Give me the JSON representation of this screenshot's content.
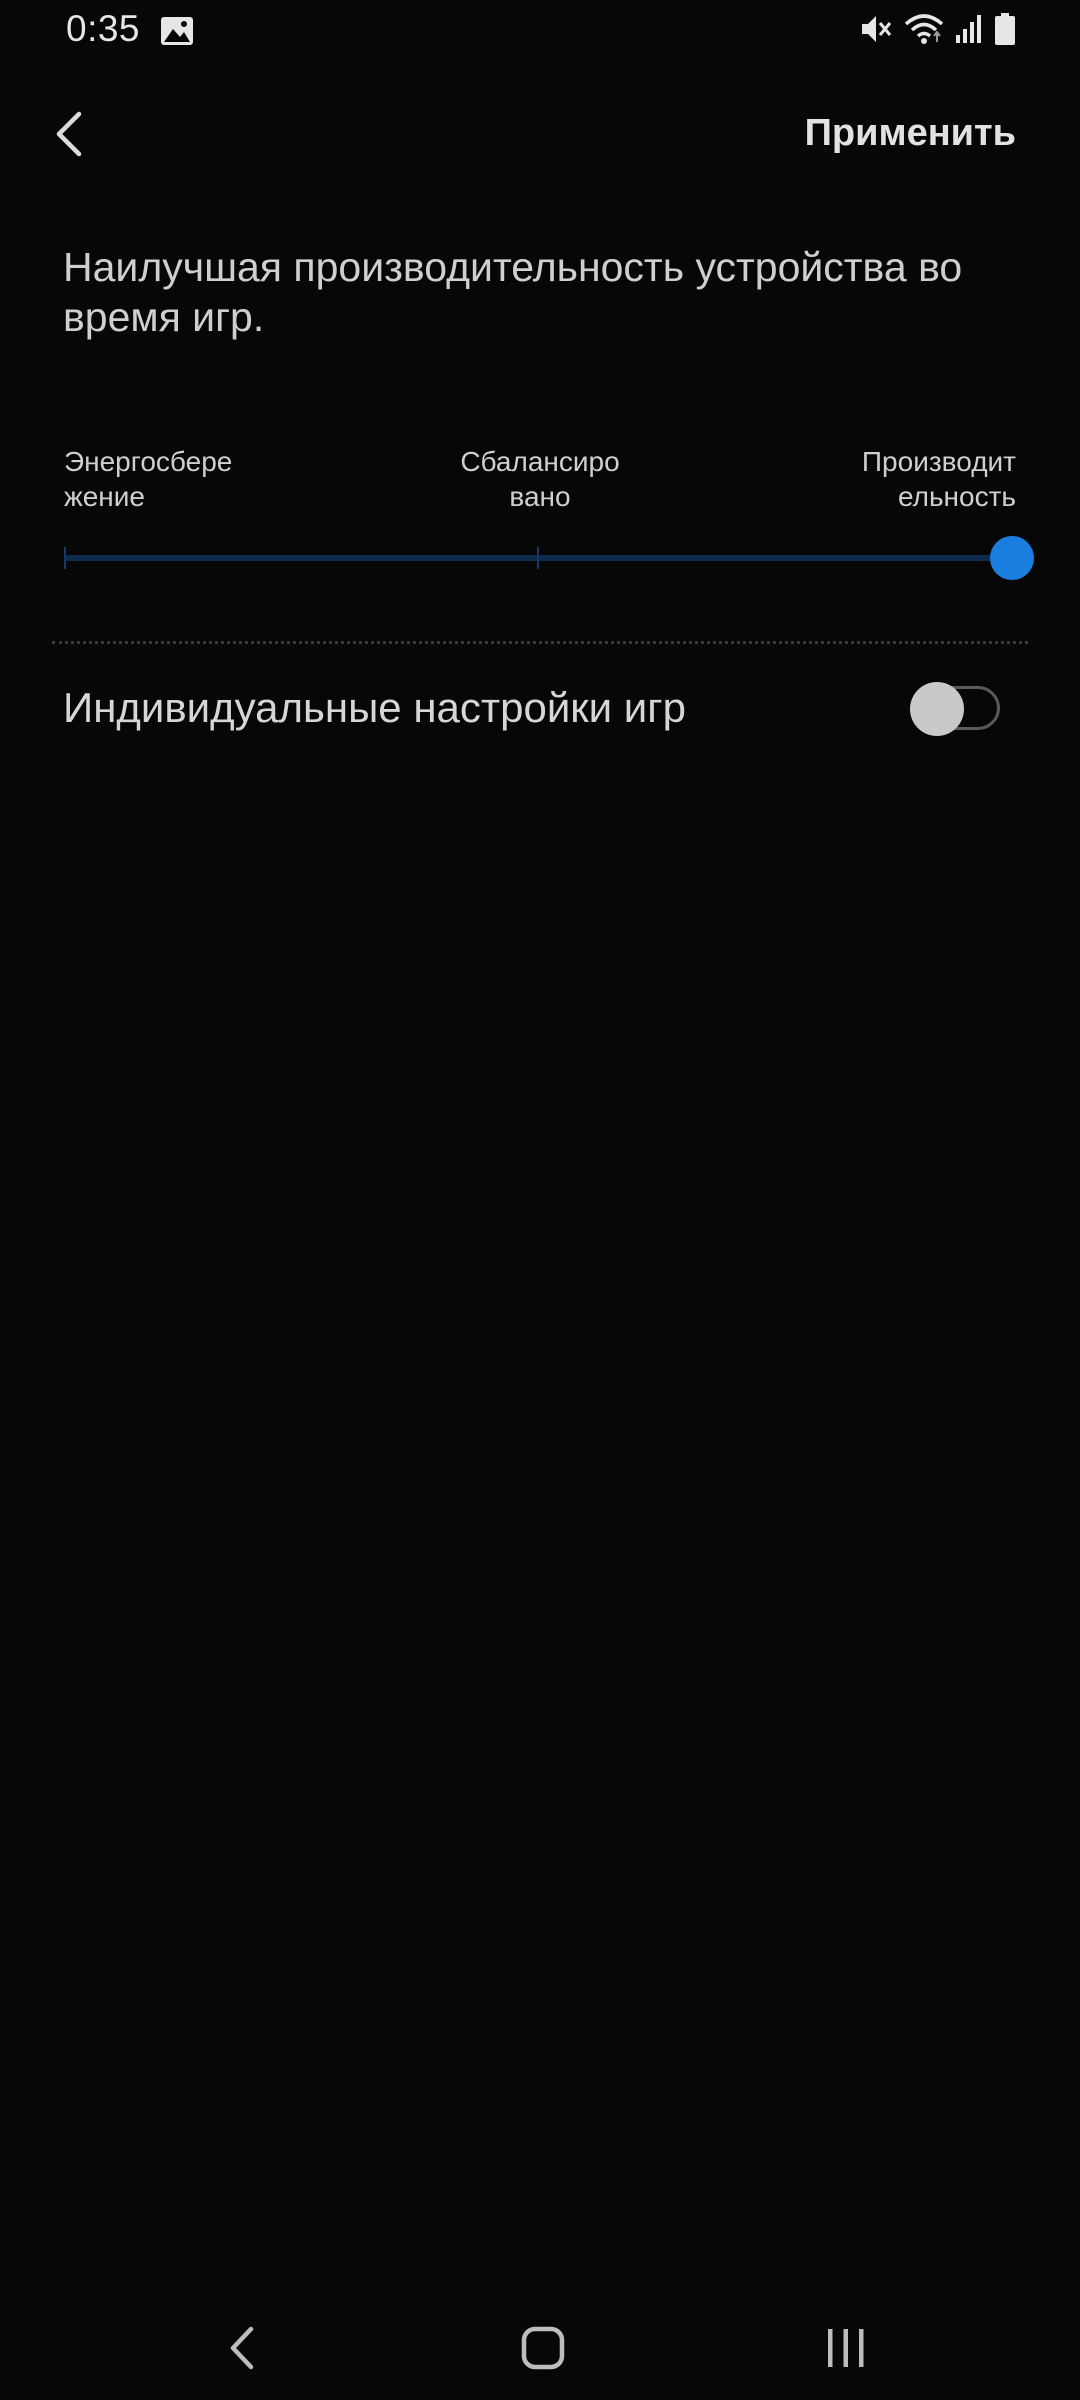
{
  "status_bar": {
    "time": "0:35",
    "icons": [
      "gallery-icon",
      "vibrate-icon",
      "wifi-icon",
      "signal-icon",
      "battery-icon"
    ]
  },
  "header": {
    "back_icon": "chevron-left-icon",
    "apply_label": "Применить"
  },
  "description": "Наилучшая производительность устройства во время игр.",
  "performance_slider": {
    "labels": [
      "Энергосбере\nжение",
      "Сбалансиро\nвано",
      "Производит\nельность"
    ],
    "selected_index": 2,
    "accent_color": "#1a7de0"
  },
  "game_settings": {
    "label": "Индивидуальные настройки игр",
    "enabled": false
  },
  "nav_bar": {
    "icons": [
      "back-icon",
      "home-icon",
      "recents-icon"
    ]
  }
}
